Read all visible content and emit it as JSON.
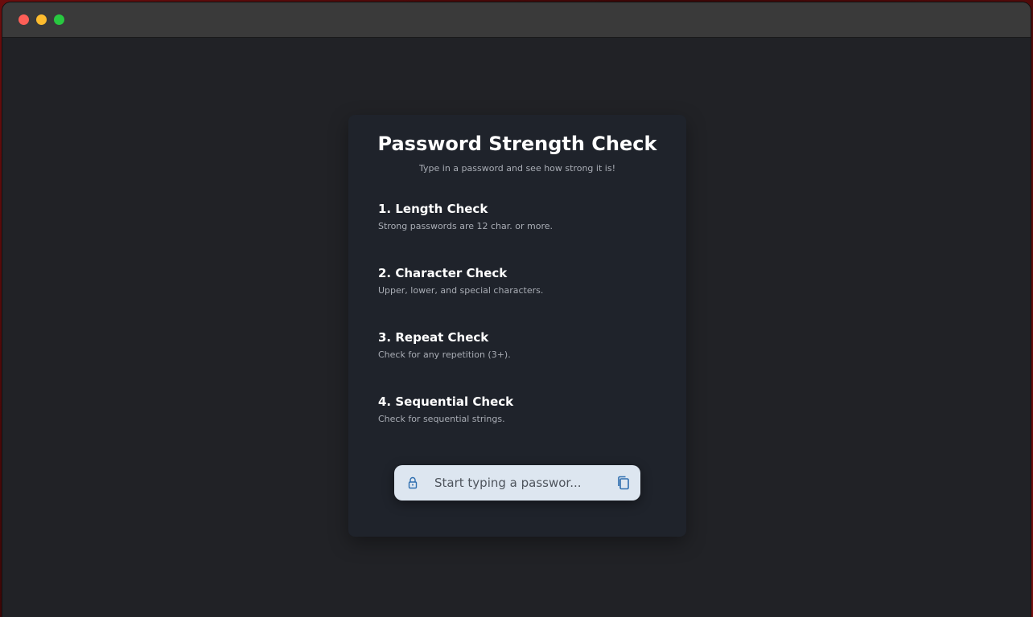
{
  "card": {
    "title": "Password Strength Check",
    "subtitle": "Type in a password and see how strong it is!"
  },
  "checks": [
    {
      "title": "1. Length Check",
      "description": "Strong passwords are 12 char. or more."
    },
    {
      "title": "2. Character Check",
      "description": "Upper, lower, and special characters."
    },
    {
      "title": "3. Repeat Check",
      "description": "Check for any repetition (3+)."
    },
    {
      "title": "4. Sequential Check",
      "description": "Check for sequential strings."
    }
  ],
  "password_input": {
    "placeholder": "Start typing a passwor...",
    "value": "",
    "leading_icon": "lock-icon",
    "trailing_icon": "copy-icon"
  },
  "colors": {
    "window_bg": "#212226",
    "card_bg": "#1f232b",
    "input_bg": "#dde6f0",
    "icon_accent": "#2f6fb0"
  }
}
